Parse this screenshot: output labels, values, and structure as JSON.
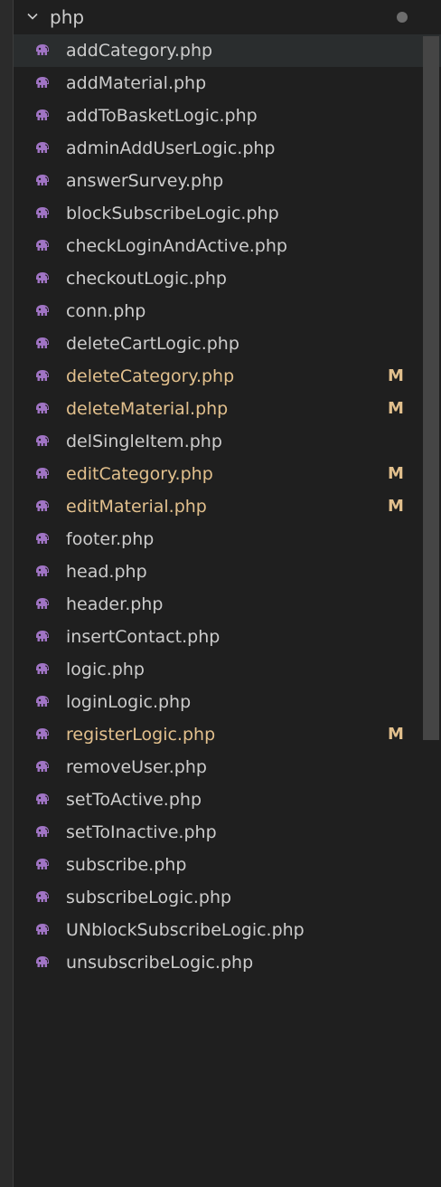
{
  "folder": {
    "name": "php",
    "expanded": true,
    "has_changes_dot": true
  },
  "colors": {
    "modified_text": "#e2c08d",
    "normal_text": "#cccccc",
    "php_icon": "#a074c4"
  },
  "files": [
    {
      "name": "addCategory.php",
      "status": "",
      "active": true
    },
    {
      "name": "addMaterial.php",
      "status": ""
    },
    {
      "name": "addToBasketLogic.php",
      "status": ""
    },
    {
      "name": "adminAddUserLogic.php",
      "status": ""
    },
    {
      "name": "answerSurvey.php",
      "status": ""
    },
    {
      "name": "blockSubscribeLogic.php",
      "status": ""
    },
    {
      "name": "checkLoginAndActive.php",
      "status": ""
    },
    {
      "name": "checkoutLogic.php",
      "status": ""
    },
    {
      "name": "conn.php",
      "status": ""
    },
    {
      "name": "deleteCartLogic.php",
      "status": ""
    },
    {
      "name": "deleteCategory.php",
      "status": "M"
    },
    {
      "name": "deleteMaterial.php",
      "status": "M"
    },
    {
      "name": "delSingleItem.php",
      "status": ""
    },
    {
      "name": "editCategory.php",
      "status": "M"
    },
    {
      "name": "editMaterial.php",
      "status": "M"
    },
    {
      "name": "footer.php",
      "status": ""
    },
    {
      "name": "head.php",
      "status": ""
    },
    {
      "name": "header.php",
      "status": ""
    },
    {
      "name": "insertContact.php",
      "status": ""
    },
    {
      "name": "logic.php",
      "status": ""
    },
    {
      "name": "loginLogic.php",
      "status": ""
    },
    {
      "name": "registerLogic.php",
      "status": "M"
    },
    {
      "name": "removeUser.php",
      "status": ""
    },
    {
      "name": "setToActive.php",
      "status": ""
    },
    {
      "name": "setToInactive.php",
      "status": ""
    },
    {
      "name": "subscribe.php",
      "status": ""
    },
    {
      "name": "subscribeLogic.php",
      "status": ""
    },
    {
      "name": "UNblockSubscribeLogic.php",
      "status": ""
    },
    {
      "name": "unsubscribeLogic.php",
      "status": ""
    }
  ]
}
